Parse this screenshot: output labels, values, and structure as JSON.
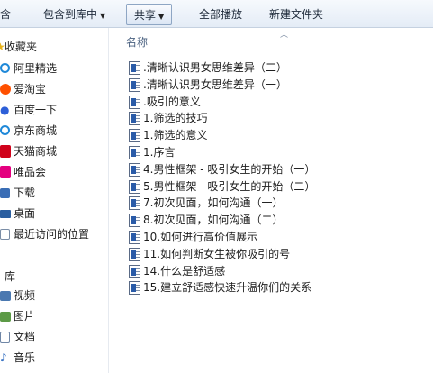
{
  "toolbar": {
    "left_cut": "含",
    "include_in_library": "包含到库中",
    "share": "共享",
    "play_all": "全部播放",
    "new_folder": "新建文件夹"
  },
  "sidebar": {
    "favorites_header": "收藏夹",
    "favorites": [
      {
        "label": "阿里精选",
        "icon": "ie-icon",
        "color": "#1e88d8"
      },
      {
        "label": "爱淘宝",
        "icon": "taobao-icon",
        "color": "#ff5000"
      },
      {
        "label": "百度一下",
        "icon": "baidu-paw-icon",
        "color": "#2d5fd8"
      },
      {
        "label": "京东商城",
        "icon": "ie-icon",
        "color": "#1e88d8"
      },
      {
        "label": "天猫商城",
        "icon": "tmall-icon",
        "color": "#d0021b"
      },
      {
        "label": "唯品会",
        "icon": "vip-icon",
        "color": "#e4007f"
      },
      {
        "label": "下载",
        "icon": "download-folder-icon",
        "color": "#3a6db5"
      },
      {
        "label": "桌面",
        "icon": "desktop-icon",
        "color": "#2b5fa0"
      },
      {
        "label": "最近访问的位置",
        "icon": "recent-places-icon",
        "color": "#7a8da6"
      }
    ],
    "libraries_header": "库",
    "libraries": [
      {
        "label": "视频",
        "icon": "video-library-icon",
        "color": "#4a78b0"
      },
      {
        "label": "图片",
        "icon": "pictures-library-icon",
        "color": "#5c9a46"
      },
      {
        "label": "文档",
        "icon": "documents-library-icon",
        "color": "#6f86a6"
      },
      {
        "label": "音乐",
        "icon": "music-library-icon",
        "color": "#3b74c4"
      }
    ]
  },
  "content": {
    "column_name": "名称",
    "files": [
      ".清晰认识男女思维差异（二）",
      ".清晰认识男女思维差异（一）",
      ".吸引的意义",
      "1.筛选的技巧",
      "1.筛选的意义",
      "1.序言",
      "4.男性框架 - 吸引女生的开始（一）",
      "5.男性框架 - 吸引女生的开始（二）",
      "7.初次见面，如何沟通（一）",
      "8.初次见面，如何沟通（二）",
      "10.如何进行高价值展示",
      "11.如何判断女生被你吸引的号",
      "14.什么是舒适感",
      "15.建立舒适感快速升温你们的关系"
    ]
  }
}
